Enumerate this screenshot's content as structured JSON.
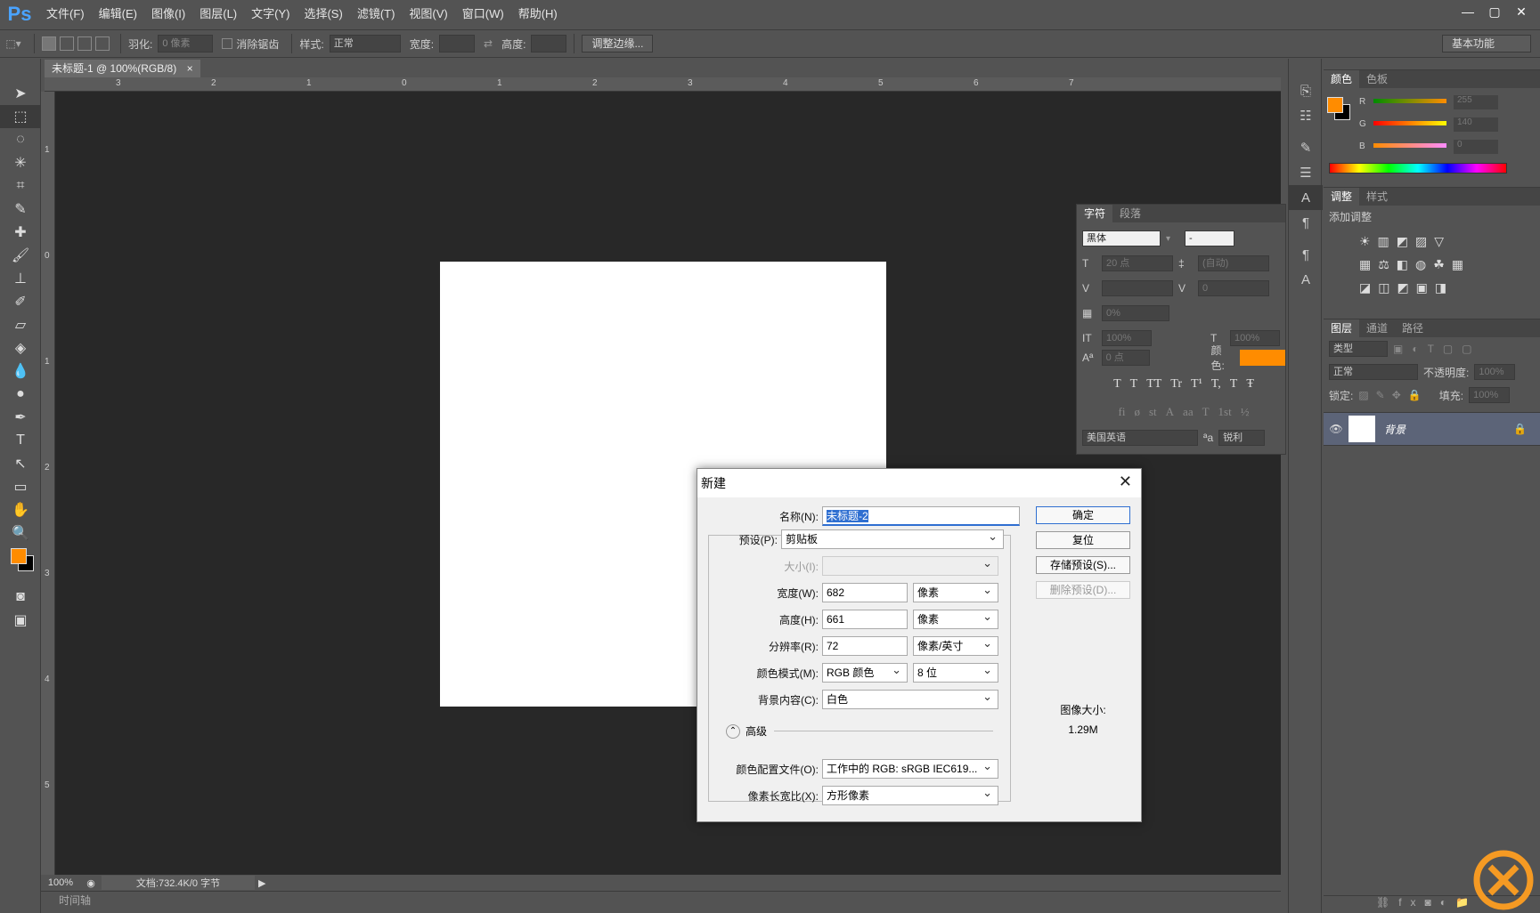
{
  "app": {
    "logo": "Ps"
  },
  "menu": [
    "文件(F)",
    "编辑(E)",
    "图像(I)",
    "图层(L)",
    "文字(Y)",
    "选择(S)",
    "滤镜(T)",
    "视图(V)",
    "窗口(W)",
    "帮助(H)"
  ],
  "window_buttons": {
    "minimize": "—",
    "restore": "▢",
    "close": "✕"
  },
  "options": {
    "feather_label": "羽化:",
    "feather_value": "0 像素",
    "antialias_label": "消除锯齿",
    "style_label": "样式:",
    "style_value": "正常",
    "width_label": "宽度:",
    "height_label": "高度:",
    "refine_button": "调整边缘...",
    "workspace": "基本功能"
  },
  "document": {
    "tab_title": "未标题-1 @ 100%(RGB/8)",
    "tab_close": "×",
    "zoom": "100%",
    "doc_info": "文档:732.4K/0 字节",
    "timeline": "时间轴",
    "ruler_h": [
      "3",
      "2",
      "1",
      "0",
      "1",
      "2",
      "3",
      "4",
      "5",
      "6",
      "7"
    ],
    "ruler_v": [
      "1",
      "0",
      "1",
      "2",
      "3",
      "4",
      "5"
    ]
  },
  "char_panel": {
    "tabs": [
      "字符",
      "段落"
    ],
    "font_family": "黑体",
    "font_style": "-",
    "size": "20 点",
    "leading": "(自动)",
    "tracking": "0",
    "scale_pct": "0%",
    "vscale": "100%",
    "hscale": "100%",
    "baseline": "0 点",
    "color_label": "颜色:",
    "color": "#ff8c00",
    "styles": [
      "T",
      "T",
      "TT",
      "Tr",
      "T¹",
      "T,",
      "T",
      "Ŧ"
    ],
    "ot_styles": [
      "fi",
      "ø",
      "st",
      "A",
      "aa",
      "T",
      "1st",
      "½"
    ],
    "language": "美国英语",
    "aa_label": "ªa",
    "aa_value": "锐利"
  },
  "color_panel": {
    "tabs": [
      "颜色",
      "色板"
    ],
    "r_label": "R",
    "r": "255",
    "g_label": "G",
    "g": "140",
    "b_label": "B",
    "b": "0",
    "fg": "#ff8c00"
  },
  "adjust_panel": {
    "tabs": [
      "调整",
      "样式"
    ],
    "title": "添加调整"
  },
  "layers_panel": {
    "tabs": [
      "图层",
      "通道",
      "路径"
    ],
    "filter": "类型",
    "blend": "正常",
    "opacity_label": "不透明度:",
    "opacity": "100%",
    "lock_label": "锁定:",
    "fill_label": "填充:",
    "fill": "100%",
    "layer_name": "背景"
  },
  "dialog": {
    "title": "新建",
    "close": "✕",
    "name_label": "名称(N):",
    "name_value": "未标题-2",
    "preset_label": "预设(P):",
    "preset_value": "剪贴板",
    "size_label": "大小(I):",
    "width_label": "宽度(W):",
    "width_value": "682",
    "width_unit": "像素",
    "height_label": "高度(H):",
    "height_value": "661",
    "height_unit": "像素",
    "res_label": "分辨率(R):",
    "res_value": "72",
    "res_unit": "像素/英寸",
    "mode_label": "颜色模式(M):",
    "mode_value": "RGB 颜色",
    "bits_value": "8 位",
    "bg_label": "背景内容(C):",
    "bg_value": "白色",
    "advanced": "高级",
    "profile_label": "颜色配置文件(O):",
    "profile_value": "工作中的 RGB: sRGB IEC619...",
    "aspect_label": "像素长宽比(X):",
    "aspect_value": "方形像素",
    "ok": "确定",
    "reset": "复位",
    "save_preset": "存储预设(S)...",
    "delete_preset": "删除预设(D)...",
    "image_size_label": "图像大小:",
    "image_size_value": "1.29M"
  }
}
